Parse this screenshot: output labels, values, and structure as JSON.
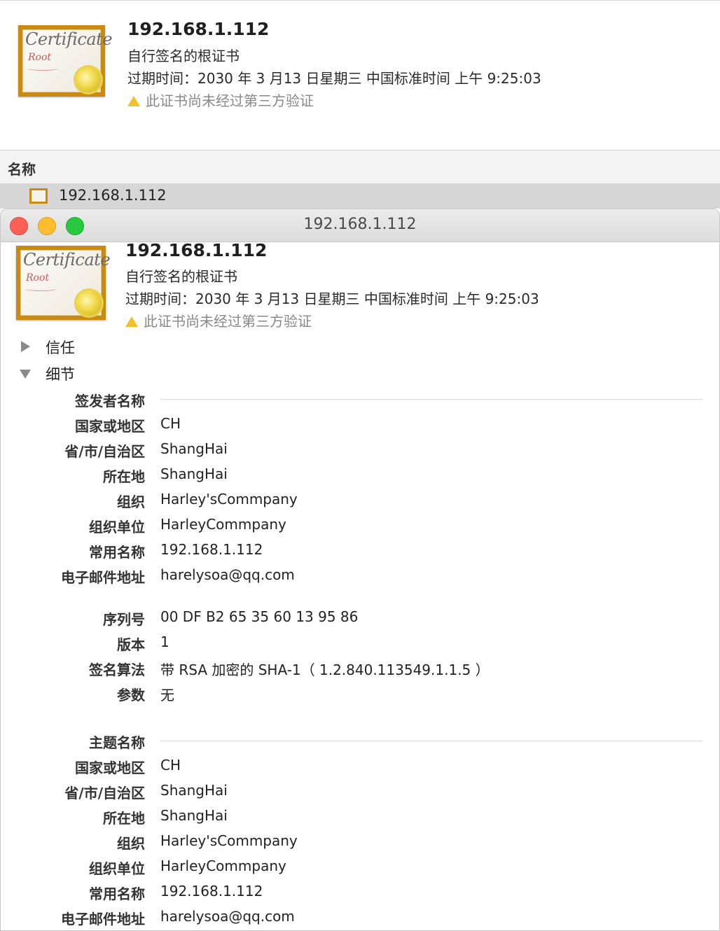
{
  "top_panel": {
    "icon": {
      "word": "Certificate",
      "sub": "Root"
    },
    "title": "192.168.1.112",
    "kind": "自行签名的根证书",
    "expiry": "过期时间：2030 年 3 月13 日星期三 中国标准时间 上午 9:25:03",
    "warning": "此证书尚未经过第三方验证"
  },
  "list": {
    "column_header": "名称",
    "row_label": "192.168.1.112"
  },
  "window": {
    "title": "192.168.1.112",
    "header": {
      "title": "192.168.1.112",
      "kind": "自行签名的根证书",
      "expiry": "过期时间：2030 年 3 月13 日星期三 中国标准时间 上午 9:25:03",
      "warning": "此证书尚未经过第三方验证"
    },
    "trust_label": "信任",
    "details_label": "细节",
    "issuer": {
      "section": "签发者名称",
      "country_label": "国家或地区",
      "country": "CH",
      "state_label": "省/市/自治区",
      "state": "ShangHai",
      "locality_label": "所在地",
      "locality": "ShangHai",
      "org_label": "组织",
      "org": "Harley'sCommpany",
      "unit_label": "组织单位",
      "unit": "HarleyCommpany",
      "cn_label": "常用名称",
      "cn": "192.168.1.112",
      "email_label": "电子邮件地址",
      "email": "harelysoa@qq.com"
    },
    "meta": {
      "serial_label": "序列号",
      "serial": "00 DF B2 65 35 60 13 95 86",
      "version_label": "版本",
      "version": "1",
      "algo_label": "签名算法",
      "algo": "带 RSA 加密的 SHA-1（ 1.2.840.113549.1.1.5 ）",
      "params_label": "参数",
      "params": "无"
    },
    "subject": {
      "section": "主题名称",
      "country_label": "国家或地区",
      "country": "CH",
      "state_label": "省/市/自治区",
      "state": "ShangHai",
      "locality_label": "所在地",
      "locality": "ShangHai",
      "org_label": "组织",
      "org": "Harley'sCommpany",
      "unit_label": "组织单位",
      "unit": "HarleyCommpany",
      "cn_label": "常用名称",
      "cn": "192.168.1.112",
      "email_label": "电子邮件地址",
      "email": "harelysoa@qq.com"
    }
  }
}
